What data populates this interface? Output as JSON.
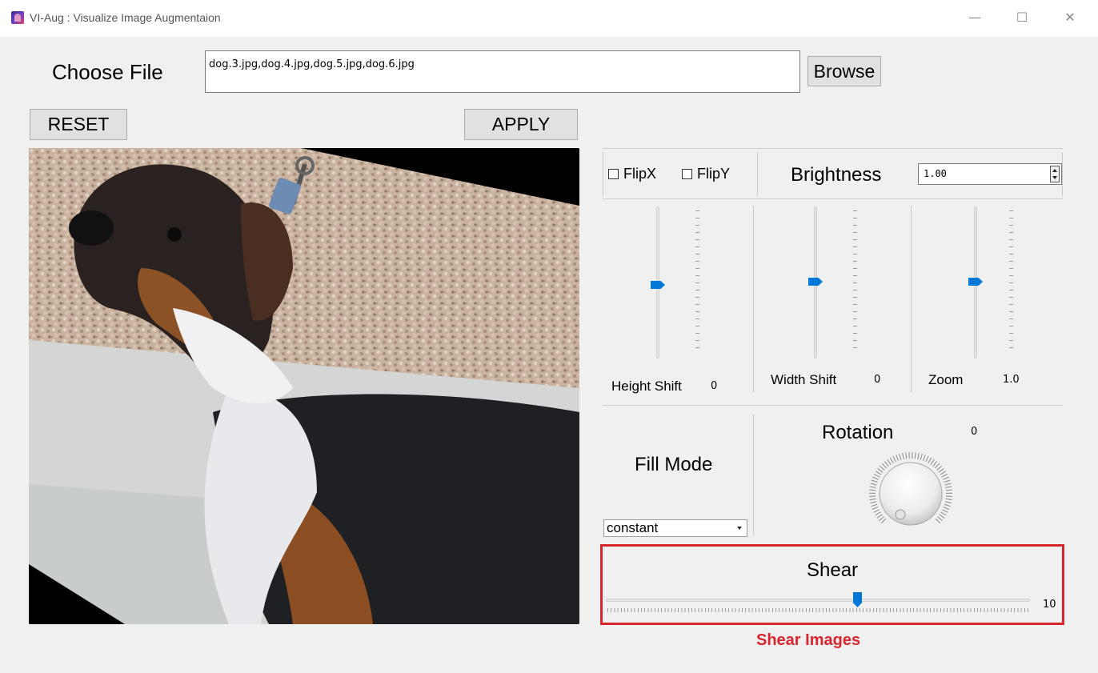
{
  "window": {
    "title": "VI-Aug : Visualize Image Augmentaion",
    "minimize": "—",
    "maximize": "☐",
    "close": "✕"
  },
  "file": {
    "label": "Choose File",
    "value": "dog.3.jpg,dog.4.jpg,dog.5.jpg,dog.6.jpg",
    "browse": "Browse"
  },
  "actions": {
    "reset": "RESET",
    "apply": "APPLY"
  },
  "flip": {
    "x_label": "FlipX",
    "y_label": "FlipY",
    "x_checked": false,
    "y_checked": false
  },
  "brightness": {
    "label": "Brightness",
    "value": "1.00"
  },
  "sliders": {
    "height_shift": {
      "label": "Height Shift",
      "value": "0"
    },
    "width_shift": {
      "label": "Width Shift",
      "value": "0"
    },
    "zoom": {
      "label": "Zoom",
      "value": "1.0"
    }
  },
  "fill_mode": {
    "label": "Fill Mode",
    "selected": "constant"
  },
  "rotation": {
    "label": "Rotation",
    "value": "0"
  },
  "shear": {
    "label": "Shear",
    "value": "10",
    "caption": "Shear Images"
  },
  "colors": {
    "accent": "#0078d7",
    "highlight": "#d7262e"
  }
}
